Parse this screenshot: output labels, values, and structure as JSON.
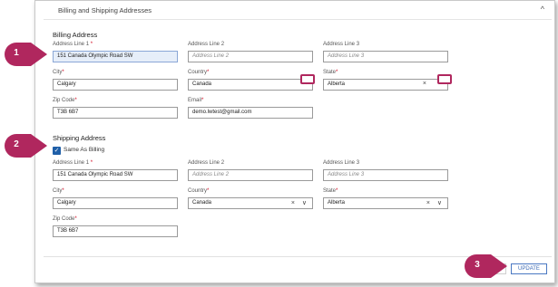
{
  "header": {
    "title": "Billing and Shipping Addresses",
    "caret": "^"
  },
  "billing": {
    "title": "Billing Address",
    "address1": {
      "label": "Address Line 1",
      "value": "151 Canada Olympic Road SW"
    },
    "address2": {
      "label": "Address Line 2",
      "placeholder": "Address Line 2"
    },
    "address3": {
      "label": "Address Line 3",
      "placeholder": "Address Line 3"
    },
    "city": {
      "label": "City",
      "value": "Calgary"
    },
    "country": {
      "label": "Country",
      "value": "Canada"
    },
    "state": {
      "label": "State",
      "value": "Alberta"
    },
    "zip": {
      "label": "Zip Code",
      "value": "T3B 6B7"
    },
    "email": {
      "label": "Email",
      "value": "demo.lwtest@gmail.com"
    }
  },
  "shipping": {
    "title": "Shipping Address",
    "same_as_billing": "Same As Billing",
    "address1": {
      "label": "Address Line 1",
      "value": "151 Canada Olympic Road SW"
    },
    "address2": {
      "label": "Address Line 2",
      "placeholder": "Address Line 2"
    },
    "address3": {
      "label": "Address Line 3",
      "placeholder": "Address Line 3"
    },
    "city": {
      "label": "City",
      "value": "Calgary"
    },
    "country": {
      "label": "Country",
      "value": "Canada"
    },
    "state": {
      "label": "State",
      "value": "Alberta"
    },
    "zip": {
      "label": "Zip Code",
      "value": "T3B 6B7"
    }
  },
  "required_mark": "*",
  "select_icons": {
    "clear": "×",
    "dropdown": "∨"
  },
  "update_button": "UPDATE",
  "callouts": [
    "1",
    "2",
    "3"
  ],
  "colors": {
    "callout": "#b0275e",
    "accent": "#1f5fa8",
    "required": "#d0021b"
  }
}
